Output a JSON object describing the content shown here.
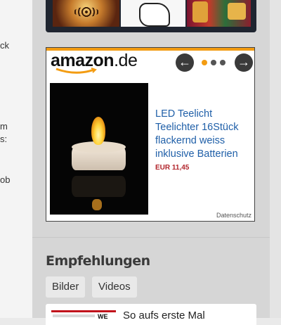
{
  "left_column": {
    "fragments": [
      "ck",
      "m",
      "s:",
      "ob"
    ]
  },
  "ad": {
    "logo_main": "amazon",
    "logo_tld": ".de",
    "prev_icon": "arrow-left-icon",
    "next_icon": "arrow-right-icon",
    "carousel_dots": 3,
    "active_dot": 1,
    "product_title": "LED Teelicht Teelichter 16Stück flackernd weiss inklusive Batterien",
    "price": "EUR 11,45",
    "privacy_link": "Datenschutz",
    "colors": {
      "accent": "#f39c12",
      "link": "#1f5fa8",
      "price": "#b1242b"
    }
  },
  "recommendations": {
    "heading": "Empfehlungen",
    "tabs": [
      "Bilder",
      "Videos"
    ],
    "article_title": "So aufs erste Mal",
    "article_thumb_text": "WE"
  }
}
